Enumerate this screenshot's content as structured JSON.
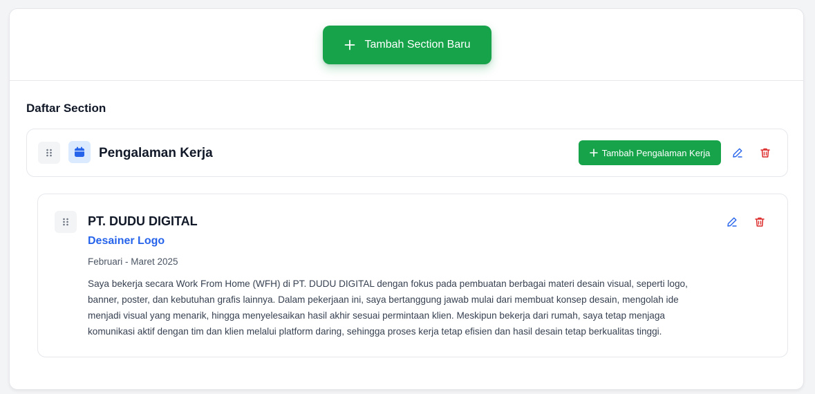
{
  "toolbar": {
    "add_section_label": "Tambah Section Baru"
  },
  "section_list": {
    "title": "Daftar Section",
    "sections": [
      {
        "title": "Pengalaman Kerja",
        "icon": "calendar-icon",
        "add_button_label": "Tambah Pengalaman Kerja",
        "entries": [
          {
            "company": "PT. DUDU DIGITAL",
            "role": "Desainer Logo",
            "period": "Februari - Maret 2025",
            "description": "Saya bekerja secara Work From Home (WFH) di PT. DUDU DIGITAL dengan fokus pada pembuatan berbagai materi desain visual, seperti logo, banner, poster, dan kebutuhan grafis lainnya. Dalam pekerjaan ini, saya bertanggung jawab mulai dari membuat konsep desain, mengolah ide menjadi visual yang menarik, hingga menyelesaikan hasil akhir sesuai permintaan klien. Meskipun bekerja dari rumah, saya tetap menjaga komunikasi aktif dengan tim dan klien melalui platform daring, sehingga proses kerja tetap efisien dan hasil desain tetap berkualitas tinggi."
          }
        ]
      }
    ]
  },
  "colors": {
    "primary_green": "#16a34a",
    "accent_blue": "#2563eb",
    "danger_red": "#dc2626"
  }
}
